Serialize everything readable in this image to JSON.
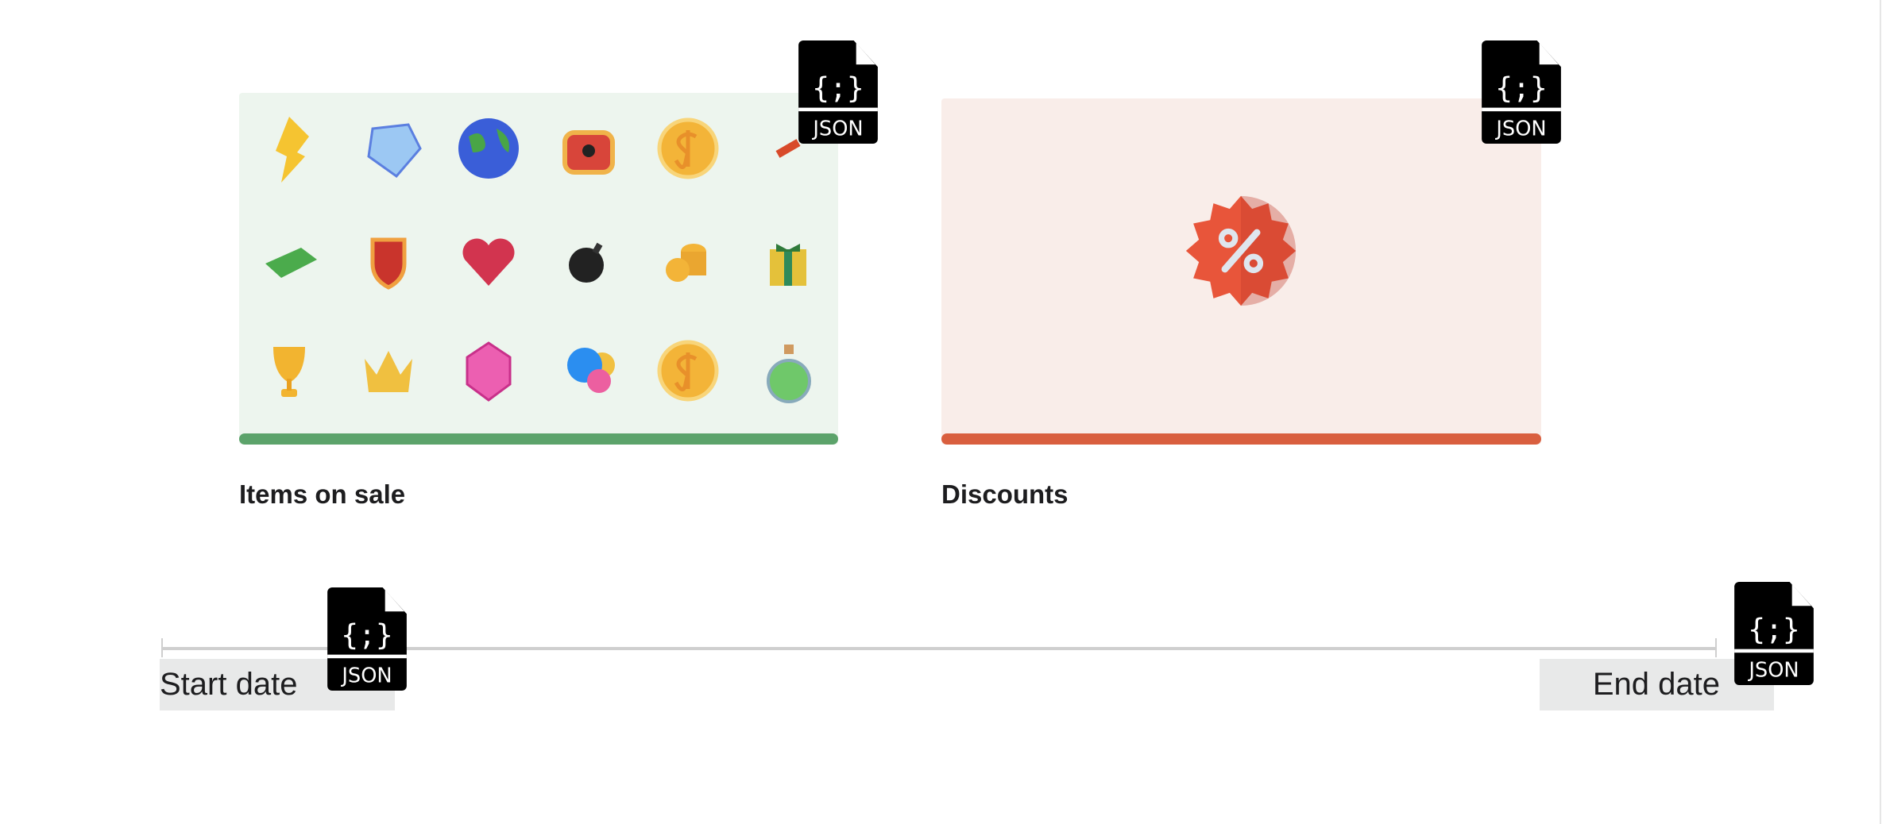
{
  "cards": [
    {
      "label": "Items on sale",
      "color": "#5ca36b",
      "background": "#edf5ee",
      "badge_icon": "json-file-icon",
      "items": [
        "lightning-crystal",
        "diamond",
        "globe",
        "treasure-chest",
        "gold-coin",
        "scroll",
        "cash-stack",
        "shield",
        "heart",
        "bomb",
        "coin-stack",
        "gift-box",
        "trophy",
        "crown",
        "pink-gem",
        "orbs",
        "gold-coin",
        "potion"
      ]
    },
    {
      "label": "Discounts",
      "color": "#d95f3f",
      "background": "#f9ede9",
      "badge_icon": "json-file-icon",
      "icon": "discount-percent-badge-icon"
    }
  ],
  "timeline": {
    "start_label": "Start date",
    "end_label": "End date",
    "badge_icon": "json-file-icon"
  },
  "json_icon_text": "JSON"
}
